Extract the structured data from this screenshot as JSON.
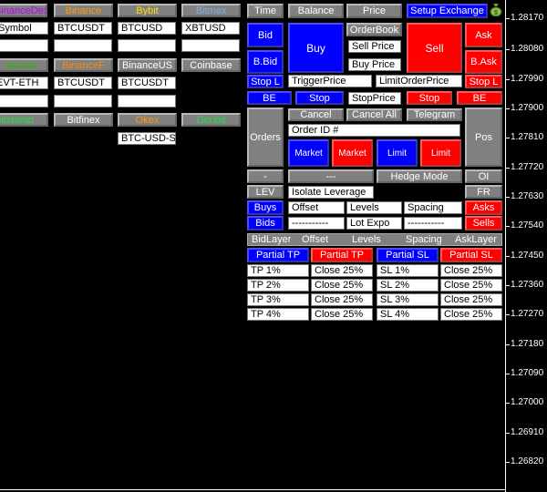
{
  "exchanges": {
    "binancedex": {
      "label": "BinanceDex",
      "color": "#c000ff"
    },
    "binance": {
      "label": "Binance",
      "color": "#ff9900"
    },
    "bybit": {
      "label": "Bybit",
      "color": "#ffdd00"
    },
    "bitmex": {
      "label": "Bitmex",
      "color": "#7fb0e0"
    },
    "kucoin": {
      "label": "Kucoin",
      "color": "#20c000"
    },
    "binancef": {
      "label": "BinanceF",
      "color": "#ff8800"
    },
    "binanceus": {
      "label": "BinanceUS",
      "color": "#ffffff"
    },
    "coinbase": {
      "label": "Coinbase",
      "color": "#ffffff"
    },
    "bitstamp": {
      "label": "Bitstamp",
      "color": "#20e040"
    },
    "bitfinex": {
      "label": "Bitfinex",
      "color": "#ffffff"
    },
    "okex": {
      "label": "Okex",
      "color": "#ff9900"
    },
    "deribit": {
      "label": "Deribit",
      "color": "#20e040"
    }
  },
  "symbols": {
    "binancedex": "Symbol",
    "binance": "BTCUSDT",
    "bybit": "BTCUSD",
    "bitmex": "XBTUSD",
    "kucoin": "EVT-ETH",
    "binancef": "BTCUSDT",
    "binanceus": "BTCUSDT",
    "okex": "BTC-USD-SWAP"
  },
  "top": {
    "time": "Time",
    "balance": "Balance",
    "price": "Price",
    "setup": "Setup Exchange"
  },
  "trade": {
    "bid": "Bid",
    "buy": "Buy",
    "orderbook": "OrderBook",
    "sell": "Sell",
    "ask": "Ask",
    "bbid": "B.Bid",
    "sell_price": "Sell Price",
    "buy_price": "Buy Price",
    "bask": "B.Ask",
    "stop_l_left": "Stop L",
    "trigger_price": "TriggerPrice",
    "limit_order_price": "LimitOrderPrice",
    "stop_l_right": "Stop L",
    "be_left": "BE",
    "stop_blue": "Stop",
    "stop_price": "StopPrice",
    "stop_red": "Stop",
    "be_right": "BE"
  },
  "orders": {
    "orders": "Orders",
    "cancel": "Cancel",
    "cancel_all": "Cancel All",
    "telegram": "Telegram",
    "order_id": "Order ID #",
    "market_blue": "Market",
    "market_red": "Market",
    "limit_blue": "Limit",
    "limit_red": "Limit",
    "pos": "Pos"
  },
  "hedge": {
    "minus": "-",
    "dashes": "---",
    "hedge_mode": "Hedge Mode",
    "oi": "OI",
    "lev": "LEV",
    "isolate": "Isolate Leverage",
    "fr": "FR"
  },
  "layers": {
    "buys": "Buys",
    "offset": "Offset",
    "levels": "Levels",
    "spacing": "Spacing",
    "asks": "Asks",
    "bids": "Bids",
    "dash1": "-----------",
    "lot_expo": "Lot Expo",
    "dash2": "-----------",
    "sells": "Sells",
    "hdr_bid_layer": "BidLayer",
    "hdr_offset": "Offset",
    "hdr_levels": "Levels",
    "hdr_spacing": "Spacing",
    "hdr_ask_layer": "AskLayer"
  },
  "partial": {
    "tp_blue": "Partial TP",
    "tp_red": "Partial TP",
    "sl_blue": "Partial SL",
    "sl_red": "Partial SL",
    "rows": [
      {
        "tp": "TP 1%",
        "tpclose": "Close 25%",
        "sl": "SL 1%",
        "slclose": "Close 25%"
      },
      {
        "tp": "TP 2%",
        "tpclose": "Close 25%",
        "sl": "SL 2%",
        "slclose": "Close 25%"
      },
      {
        "tp": "TP 3%",
        "tpclose": "Close 25%",
        "sl": "SL 3%",
        "slclose": "Close 25%"
      },
      {
        "tp": "TP 4%",
        "tpclose": "Close 25%",
        "sl": "SL 4%",
        "slclose": "Close 25%"
      }
    ]
  },
  "price_axis": [
    "1.28170",
    "1.28080",
    "1.27990",
    "1.27900",
    "1.27810",
    "1.27720",
    "1.27630",
    "1.27540",
    "1.27450",
    "1.27360",
    "1.27270",
    "1.27180",
    "1.27090",
    "1.27000",
    "1.26910",
    "1.26820"
  ],
  "colors": {
    "blue": "#0000ff",
    "red": "#ff0000",
    "gray": "#808080",
    "background": "#000000"
  }
}
